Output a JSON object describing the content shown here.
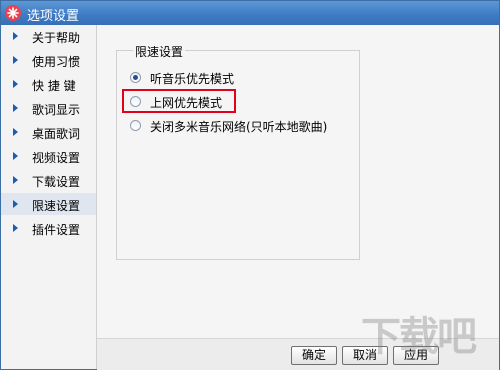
{
  "window": {
    "title": "选项设置"
  },
  "sidebar": {
    "items": [
      {
        "label": "关于帮助"
      },
      {
        "label": "使用习惯"
      },
      {
        "label": "快 捷 键"
      },
      {
        "label": "歌词显示"
      },
      {
        "label": "桌面歌词"
      },
      {
        "label": "视频设置"
      },
      {
        "label": "下载设置"
      },
      {
        "label": "限速设置",
        "selected": true
      },
      {
        "label": "插件设置"
      }
    ]
  },
  "main": {
    "group_title": "限速设置",
    "options": [
      {
        "label": "听音乐优先模式",
        "checked": true
      },
      {
        "label": "上网优先模式",
        "checked": false,
        "highlighted": true
      },
      {
        "label": "关闭多米音乐网络(只听本地歌曲)",
        "checked": false
      }
    ]
  },
  "buttons": {
    "ok": "确定",
    "cancel": "取消",
    "apply": "应用"
  },
  "watermark": "下载吧",
  "colors": {
    "titlebar": "#3f7cc5",
    "highlight": "#e3001b",
    "nav_arrow": "#1e5cb3",
    "selected_bg": "#dfe6ef"
  }
}
